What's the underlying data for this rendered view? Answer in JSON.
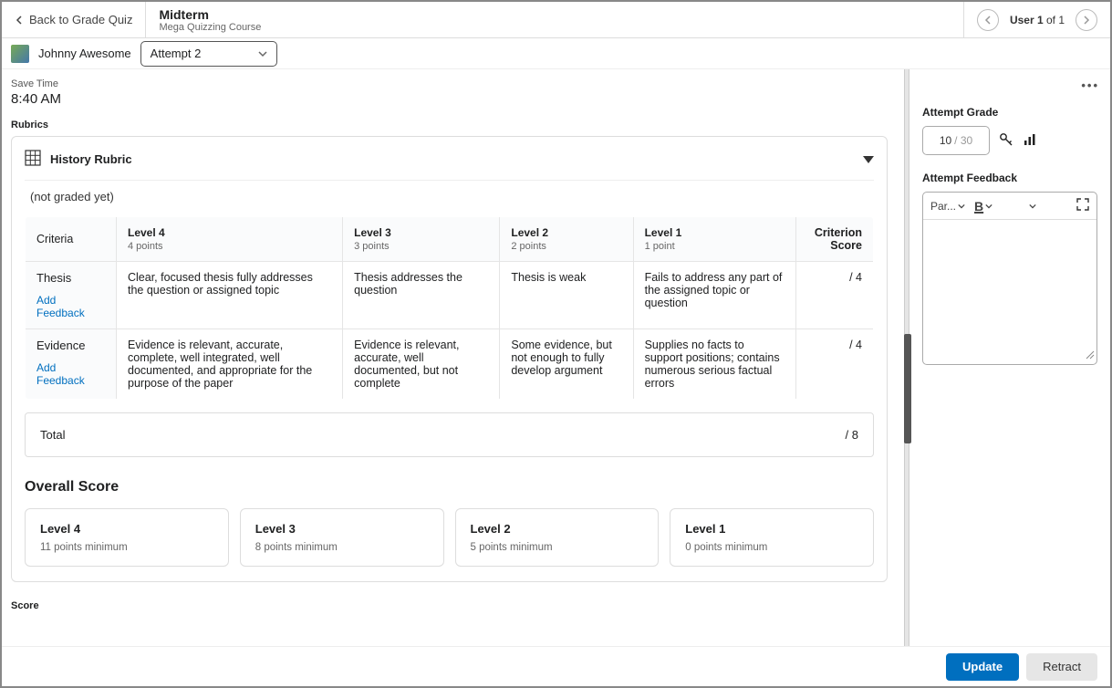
{
  "header": {
    "back_label": "Back to Grade Quiz",
    "title": "Midterm",
    "subtitle": "Mega Quizzing Course",
    "user_nav_current": "User 1",
    "user_nav_of": "of 1"
  },
  "subheader": {
    "student_name": "Johnny Awesome",
    "attempt_label": "Attempt 2"
  },
  "main": {
    "save_time_label": "Save Time",
    "save_time_value": "8:40 AM",
    "rubrics_label": "Rubrics",
    "rubric_title": "History Rubric",
    "not_graded": "(not graded yet)",
    "headers": {
      "criteria": "Criteria",
      "score": "Criterion Score"
    },
    "levels": [
      {
        "name": "Level 4",
        "points": "4 points"
      },
      {
        "name": "Level 3",
        "points": "3 points"
      },
      {
        "name": "Level 2",
        "points": "2 points"
      },
      {
        "name": "Level 1",
        "points": "1 point"
      }
    ],
    "rows": [
      {
        "name": "Thesis",
        "add_feedback": "Add Feedback",
        "cells": [
          "Clear, focused thesis fully addresses the question or assigned topic",
          "Thesis addresses the question",
          "Thesis is weak",
          "Fails to address any part of the assigned topic or question"
        ],
        "score": "/ 4"
      },
      {
        "name": "Evidence",
        "add_feedback": "Add Feedback",
        "cells": [
          "Evidence is relevant, accurate, complete, well integrated, well documented, and appropriate for the purpose of the paper",
          "Evidence is relevant, accurate, well documented, but not complete",
          "Some evidence, but not enough to fully develop argument",
          "Supplies no facts to support positions; contains numerous serious factual errors"
        ],
        "score": "/ 4"
      }
    ],
    "total_label": "Total",
    "total_score": "/ 8",
    "overall_heading": "Overall Score",
    "overall_levels": [
      {
        "name": "Level 4",
        "sub": "11 points minimum"
      },
      {
        "name": "Level 3",
        "sub": "8 points minimum"
      },
      {
        "name": "Level 2",
        "sub": "5 points minimum"
      },
      {
        "name": "Level 1",
        "sub": "0 points minimum"
      }
    ],
    "score_label": "Score"
  },
  "side": {
    "attempt_grade_label": "Attempt Grade",
    "grade_value": "10",
    "grade_outof": "/ 30",
    "feedback_label": "Attempt Feedback",
    "para_label": "Par..."
  },
  "footer": {
    "update": "Update",
    "retract": "Retract"
  }
}
